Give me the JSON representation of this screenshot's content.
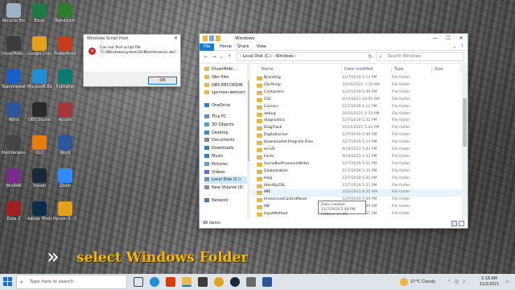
{
  "desktop": {
    "icons": [
      {
        "label": "Recycle Bin",
        "icon": "recycle-bin-icon",
        "color": "#9fb3c8"
      },
      {
        "label": "Excel",
        "icon": "excel-icon",
        "color": "#1d7a43"
      },
      {
        "label": "Bandicam",
        "icon": "bandicam-icon",
        "color": "#2c7d2c"
      },
      {
        "label": "DivanMobi...",
        "icon": "app-icon",
        "color": "#3b3b3b"
      },
      {
        "label": "Google Chrome",
        "icon": "chrome-icon",
        "color": "#e3a21a"
      },
      {
        "label": "PowerPoint",
        "icon": "powerpoint-icon",
        "color": "#c43e1c"
      },
      {
        "label": "TeamViewer",
        "icon": "teamviewer-icon",
        "color": "#1a5fc8"
      },
      {
        "label": "Microsoft Edge",
        "icon": "edge-icon",
        "color": "#1f8fd6"
      },
      {
        "label": "Publisher",
        "icon": "publisher-icon",
        "color": "#087a6f"
      },
      {
        "label": "Word",
        "icon": "word-icon",
        "color": "#2b579a"
      },
      {
        "label": "OBS Studio",
        "icon": "obs-icon",
        "color": "#2a2a2a"
      },
      {
        "label": "Access",
        "icon": "access-icon",
        "color": "#a4373a"
      },
      {
        "label": "Maintenance",
        "icon": "script-icon",
        "color": "#444"
      },
      {
        "label": "VLC",
        "icon": "vlc-icon",
        "color": "#e87d0d"
      },
      {
        "label": "Word",
        "icon": "word-icon",
        "color": "#2b579a"
      },
      {
        "label": "WinRAR",
        "icon": "winrar-icon",
        "color": "#7a2c8c"
      },
      {
        "label": "Steam",
        "icon": "steam-icon",
        "color": "#1b2838"
      },
      {
        "label": "Zoom",
        "icon": "zoom-icon",
        "color": "#2d8cff"
      },
      {
        "label": "Dota 2",
        "icon": "dota-icon",
        "color": "#a02020"
      },
      {
        "label": "Adobe Photoshop",
        "icon": "photoshop-icon",
        "color": "#0b2c4a"
      },
      {
        "label": "Person 1 - Chrome",
        "icon": "chrome-icon",
        "color": "#e3a21a"
      }
    ]
  },
  "dialog": {
    "title": "Windows Script Host",
    "message_line1": "Can not find script file",
    "message_line2": "\"C:\\Windows\\system32\\Maintenance.vbs\".",
    "ok_label": "OK",
    "close": "✕"
  },
  "explorer": {
    "title": "Windows",
    "ribbon_tabs": [
      "File",
      "Home",
      "Share",
      "View"
    ],
    "address": "›  Local Disk (C:)  ›  Windows  ›",
    "search_placeholder": "Search Windows",
    "columns": {
      "name": "Name",
      "date": "Date modified",
      "type": "Type",
      "size": "Size"
    },
    "nav_items": [
      {
        "label": "DivanMobi...",
        "color": "#e8b84a"
      },
      {
        "label": "Obs files",
        "color": "#e8b84a"
      },
      {
        "label": "OBS RECORDIN",
        "color": "#e8b84a"
      },
      {
        "label": "spcnoon-welcom",
        "color": "#e8b84a"
      },
      {
        "label": "OneDrive",
        "color": "#2f7dd1"
      },
      {
        "label": "This PC",
        "color": "#5a8fd0"
      },
      {
        "label": "3D Objects",
        "color": "#4aa3d8"
      },
      {
        "label": "Desktop",
        "color": "#3a86d0"
      },
      {
        "label": "Documents",
        "color": "#8a8a8a"
      },
      {
        "label": "Downloads",
        "color": "#2f7dd1"
      },
      {
        "label": "Music",
        "color": "#2f7dd1"
      },
      {
        "label": "Pictures",
        "color": "#5aa0d8"
      },
      {
        "label": "Videos",
        "color": "#5a6fd8"
      },
      {
        "label": "Local Disk (C:)",
        "color": "#7a8fa8"
      },
      {
        "label": "New Volume (D:",
        "color": "#7a8fa8"
      },
      {
        "label": "Network",
        "color": "#4a7ab0"
      }
    ],
    "files": [
      {
        "name": "Branding",
        "date": "12/7/2019 5:14 PM",
        "type": "File folder"
      },
      {
        "name": "CbsTemp",
        "date": "10/16/2021 7:36 AM",
        "type": "File folder"
      },
      {
        "name": "Containers",
        "date": "12/7/2019 5:49 PM",
        "type": "File folder"
      },
      {
        "name": "CSC",
        "date": "9/15/2021 10:05 AM",
        "type": "File folder"
      },
      {
        "name": "Cursors",
        "date": "12/7/2019 5:14 PM",
        "type": "File folder"
      },
      {
        "name": "debug",
        "date": "10/10/2021 2:25 PM",
        "type": "File folder"
      },
      {
        "name": "diagnostics",
        "date": "12/7/2019 5:31 PM",
        "type": "File folder"
      },
      {
        "name": "DiagTrack",
        "date": "10/16/2021 5:42 PM",
        "type": "File folder"
      },
      {
        "name": "DigitalLocker",
        "date": "12/7/2019 5:49 PM",
        "type": "File folder"
      },
      {
        "name": "Downloaded Program Files",
        "date": "12/7/2019 5:14 PM",
        "type": "File folder"
      },
      {
        "name": "en-US",
        "date": "9/19/2021 5:43 PM",
        "type": "File folder"
      },
      {
        "name": "Fonts",
        "date": "9/19/2021 5:43 PM",
        "type": "File folder"
      },
      {
        "name": "GameBarPresenceWriter",
        "date": "12/7/2019 5:31 PM",
        "type": "File folder"
      },
      {
        "name": "Globalization",
        "date": "12/7/2019 5:31 PM",
        "type": "File folder"
      },
      {
        "name": "Help",
        "date": "12/7/2019 5:31 PM",
        "type": "File folder"
      },
      {
        "name": "IdentityCRL",
        "date": "12/7/2019 5:31 PM",
        "type": "File folder"
      },
      {
        "name": "IME",
        "date": "2/10/2021 8:25 AM",
        "type": "File folder"
      },
      {
        "name": "ImmersiveControlPanel",
        "date": "12/7/2019 5:49 PM",
        "type": "File folder"
      },
      {
        "name": "INF",
        "date": "12/7/2019 5:49 PM",
        "type": "File folder"
      },
      {
        "name": "InputMethod",
        "date": "12/7/2019 5:31 PM",
        "type": "File folder"
      }
    ],
    "tooltip_line1": "Date created: 12/7/2019 5:49 PM",
    "tooltip_line2": "Folders: en-US",
    "status": "96 items"
  },
  "caption": {
    "chevrons": "»",
    "text": "select Windows Folder"
  },
  "taskbar": {
    "search_placeholder": "Type here to search",
    "weather": "27°C  Cloudy",
    "time": "5:18 AM",
    "date": "11/3/2021"
  }
}
